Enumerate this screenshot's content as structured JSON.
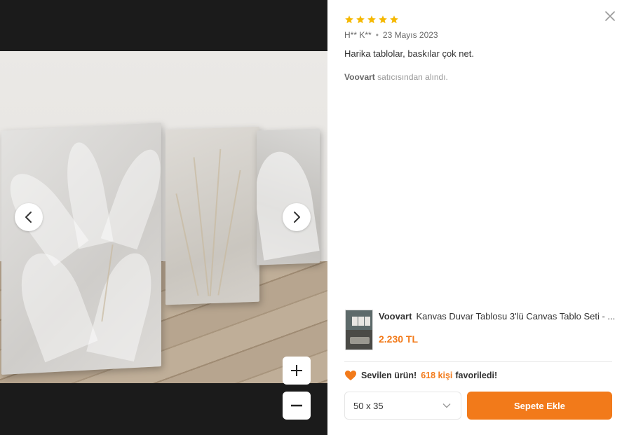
{
  "review": {
    "rating": 5,
    "author": "H** K**",
    "date": "23 Mayıs 2023",
    "comment": "Harika tablolar, baskılar çok net.",
    "seller_name": "Voovart",
    "seller_suffix": "satıcısından alındı."
  },
  "product": {
    "brand": "Voovart",
    "title": "Kanvas Duvar Tablosu 3'lü Canvas Tablo Seti - ...",
    "price": "2.230 TL"
  },
  "favorite": {
    "label_prefix": "Sevilen ürün!",
    "count": "618 kişi",
    "label_suffix": "favoriledi!"
  },
  "size_select": {
    "value": "50 x 35"
  },
  "add_to_cart_label": "Sepete Ekle",
  "colors": {
    "accent": "#f27a1a",
    "star": "#f5b800",
    "heart": "#f27a1a"
  },
  "icons": [
    "chevron-left-icon",
    "chevron-right-icon",
    "plus-icon",
    "minus-icon",
    "close-icon",
    "star-icon",
    "heart-icon",
    "chevron-down-icon"
  ]
}
